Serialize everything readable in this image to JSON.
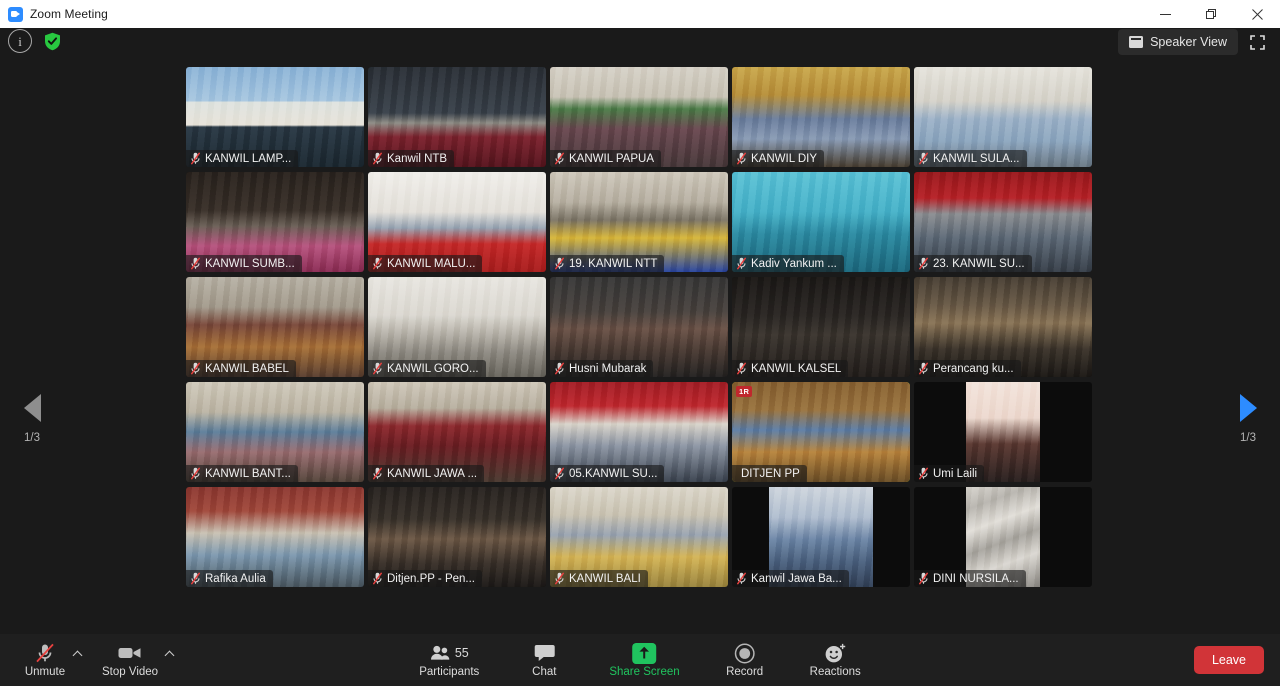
{
  "window": {
    "title": "Zoom Meeting",
    "app_icon": "zoom-camera-icon",
    "minimize_label": "Minimize",
    "maximize_label": "Restore",
    "close_label": "Close"
  },
  "topbar": {
    "info_icon": "info-icon",
    "encryption_icon": "green-shield-icon",
    "view_button_label": "Speaker View",
    "view_button_icon": "grid-view-icon",
    "fullscreen_icon": "enter-fullscreen-icon"
  },
  "pagination": {
    "left_arrow_icon": "chevron-left-icon",
    "right_arrow_icon": "chevron-right-icon",
    "left_label": "1/3",
    "right_label": "1/3",
    "left_color": "#8e8e8e",
    "right_color": "#2d8cff"
  },
  "gallery": {
    "columns": 5,
    "rows": 5,
    "active_border_color": "#b8e62a",
    "participants": [
      {
        "name": "KANWIL LAMP...",
        "muted": true,
        "active": false,
        "layout": "full",
        "badge": ""
      },
      {
        "name": "Kanwil NTB",
        "muted": true,
        "active": false,
        "layout": "full",
        "badge": ""
      },
      {
        "name": "KANWIL PAPUA",
        "muted": true,
        "active": false,
        "layout": "full",
        "badge": ""
      },
      {
        "name": "KANWIL DIY",
        "muted": true,
        "active": false,
        "layout": "full",
        "badge": ""
      },
      {
        "name": "KANWIL SULA...",
        "muted": true,
        "active": false,
        "layout": "full",
        "badge": ""
      },
      {
        "name": "KANWIL SUMB...",
        "muted": true,
        "active": false,
        "layout": "full",
        "badge": ""
      },
      {
        "name": "KANWIL MALU...",
        "muted": true,
        "active": false,
        "layout": "full",
        "badge": ""
      },
      {
        "name": "19. KANWIL NTT",
        "muted": true,
        "active": false,
        "layout": "full",
        "badge": ""
      },
      {
        "name": "Kadiv Yankum ...",
        "muted": true,
        "active": false,
        "layout": "full",
        "badge": ""
      },
      {
        "name": "23. KANWIL SU...",
        "muted": true,
        "active": false,
        "layout": "full",
        "badge": ""
      },
      {
        "name": "KANWIL BABEL",
        "muted": true,
        "active": false,
        "layout": "full",
        "badge": ""
      },
      {
        "name": "KANWIL GORO...",
        "muted": true,
        "active": false,
        "layout": "full",
        "badge": ""
      },
      {
        "name": "Husni Mubarak",
        "muted": true,
        "active": false,
        "layout": "full",
        "badge": ""
      },
      {
        "name": "KANWIL KALSEL",
        "muted": true,
        "active": false,
        "layout": "full",
        "badge": ""
      },
      {
        "name": "Perancang ku...",
        "muted": true,
        "active": false,
        "layout": "full",
        "badge": ""
      },
      {
        "name": "KANWIL BANT...",
        "muted": true,
        "active": false,
        "layout": "full",
        "badge": ""
      },
      {
        "name": "KANWIL JAWA ...",
        "muted": true,
        "active": false,
        "layout": "full",
        "badge": ""
      },
      {
        "name": "05.KANWIL SU...",
        "muted": true,
        "active": false,
        "layout": "full",
        "badge": ""
      },
      {
        "name": "DITJEN PP",
        "muted": false,
        "active": true,
        "layout": "full",
        "badge": "1R"
      },
      {
        "name": "Umi Laili",
        "muted": true,
        "active": false,
        "layout": "portrait",
        "badge": ""
      },
      {
        "name": "Rafika Aulia",
        "muted": true,
        "active": false,
        "layout": "full",
        "badge": ""
      },
      {
        "name": "Ditjen.PP - Pen...",
        "muted": true,
        "active": false,
        "layout": "full",
        "badge": ""
      },
      {
        "name": "KANWIL BALI",
        "muted": true,
        "active": false,
        "layout": "full",
        "badge": ""
      },
      {
        "name": "Kanwil Jawa Ba...",
        "muted": true,
        "active": false,
        "layout": "narrow",
        "badge": ""
      },
      {
        "name": "DINI NURSILA...",
        "muted": true,
        "active": false,
        "layout": "portrait",
        "badge": ""
      }
    ]
  },
  "toolbar": {
    "audio": {
      "label": "Unmute",
      "icon": "microphone-muted-icon",
      "caret_icon": "chevron-up-icon"
    },
    "video": {
      "label": "Stop Video",
      "icon": "video-camera-icon",
      "caret_icon": "chevron-up-icon"
    },
    "participants": {
      "label": "Participants",
      "count": "55",
      "icon": "people-icon"
    },
    "chat": {
      "label": "Chat",
      "icon": "chat-bubble-icon"
    },
    "share": {
      "label": "Share Screen",
      "icon": "share-screen-up-arrow-icon",
      "color": "#20c45f"
    },
    "record": {
      "label": "Record",
      "icon": "record-circle-icon"
    },
    "reactions": {
      "label": "Reactions",
      "icon": "smiley-plus-icon"
    },
    "leave": {
      "label": "Leave",
      "color": "#d13438"
    }
  }
}
